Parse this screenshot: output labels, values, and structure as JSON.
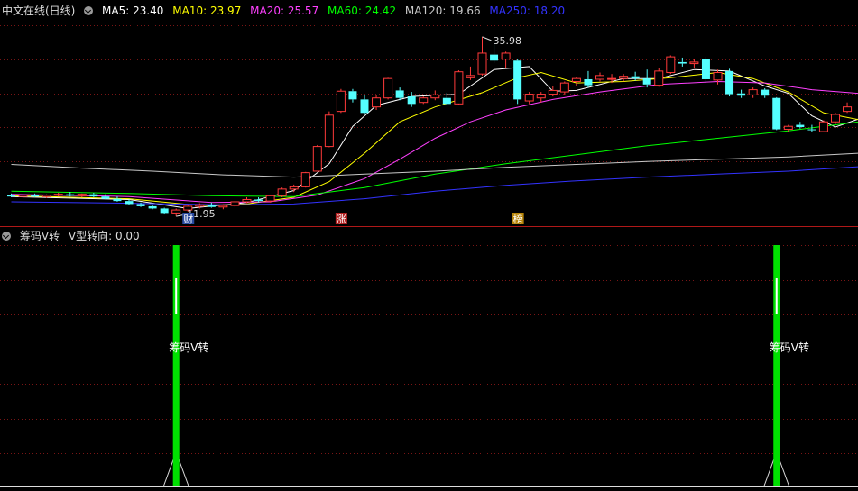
{
  "main_legend": {
    "title": "中文在线(日线)",
    "items": [
      {
        "label": "MA5: 23.40",
        "color": "#ffffff"
      },
      {
        "label": "MA10: 23.97",
        "color": "#ffff00"
      },
      {
        "label": "MA20: 25.57",
        "color": "#ff40ff"
      },
      {
        "label": "MA60: 24.42",
        "color": "#00ff00"
      },
      {
        "label": "MA120: 19.66",
        "color": "#c8c8c8"
      },
      {
        "label": "MA250: 18.20",
        "color": "#3333ff"
      }
    ]
  },
  "sub_legend": {
    "indicator": "筹码V转",
    "value_label": "V型转向: 0.00"
  },
  "annotations": {
    "high": "35.98",
    "low": "11.95",
    "markers": [
      {
        "text": "财",
        "bg": "#2a4aa0"
      },
      {
        "text": "涨",
        "bg": "#b22222"
      },
      {
        "text": "榜",
        "bg": "#b8860b"
      }
    ],
    "signal_label": "筹码V转"
  },
  "colors": {
    "up": "#ff3a3a",
    "down": "#54ffff",
    "grid": "#7a1515",
    "signal": "#00e000"
  },
  "chart_data": [
    {
      "type": "candlestick",
      "title": "中文在线(日线)",
      "note": "OHLC values estimated from candle shapes; y in price units",
      "ylim": [
        11,
        38.5
      ],
      "candles": [
        {
          "o": 14.8,
          "h": 15.0,
          "l": 14.5,
          "c": 14.6
        },
        {
          "o": 14.6,
          "h": 14.9,
          "l": 14.4,
          "c": 14.8
        },
        {
          "o": 14.8,
          "h": 15.0,
          "l": 14.5,
          "c": 14.6
        },
        {
          "o": 14.6,
          "h": 14.9,
          "l": 14.4,
          "c": 14.8
        },
        {
          "o": 14.8,
          "h": 15.1,
          "l": 14.6,
          "c": 14.9
        },
        {
          "o": 14.9,
          "h": 15.2,
          "l": 14.6,
          "c": 14.7
        },
        {
          "o": 14.7,
          "h": 15.0,
          "l": 14.5,
          "c": 14.9
        },
        {
          "o": 14.9,
          "h": 15.1,
          "l": 14.5,
          "c": 14.6
        },
        {
          "o": 14.6,
          "h": 14.9,
          "l": 14.2,
          "c": 14.3
        },
        {
          "o": 14.3,
          "h": 14.6,
          "l": 13.9,
          "c": 14.0
        },
        {
          "o": 14.0,
          "h": 14.2,
          "l": 13.5,
          "c": 13.6
        },
        {
          "o": 13.6,
          "h": 13.8,
          "l": 13.2,
          "c": 13.3
        },
        {
          "o": 13.3,
          "h": 13.5,
          "l": 12.9,
          "c": 13.0
        },
        {
          "o": 13.0,
          "h": 13.1,
          "l": 12.2,
          "c": 12.4
        },
        {
          "o": 12.4,
          "h": 13.0,
          "l": 11.95,
          "c": 12.8
        },
        {
          "o": 12.8,
          "h": 13.4,
          "l": 12.6,
          "c": 13.3
        },
        {
          "o": 13.3,
          "h": 13.7,
          "l": 13.0,
          "c": 13.5
        },
        {
          "o": 13.5,
          "h": 13.8,
          "l": 13.1,
          "c": 13.2
        },
        {
          "o": 13.2,
          "h": 13.6,
          "l": 12.9,
          "c": 13.4
        },
        {
          "o": 13.4,
          "h": 14.0,
          "l": 13.2,
          "c": 13.9
        },
        {
          "o": 13.9,
          "h": 14.5,
          "l": 13.7,
          "c": 14.2
        },
        {
          "o": 14.2,
          "h": 14.5,
          "l": 13.8,
          "c": 14.0
        },
        {
          "o": 14.0,
          "h": 14.8,
          "l": 13.8,
          "c": 14.7
        },
        {
          "o": 14.7,
          "h": 15.8,
          "l": 14.5,
          "c": 15.6
        },
        {
          "o": 15.6,
          "h": 16.2,
          "l": 15.2,
          "c": 15.9
        },
        {
          "o": 15.9,
          "h": 17.9,
          "l": 15.8,
          "c": 17.8
        },
        {
          "o": 18.0,
          "h": 21.5,
          "l": 18.0,
          "c": 21.3
        },
        {
          "o": 21.3,
          "h": 26.0,
          "l": 21.2,
          "c": 25.5
        },
        {
          "o": 26.0,
          "h": 29.0,
          "l": 25.8,
          "c": 28.7
        },
        {
          "o": 28.7,
          "h": 29.0,
          "l": 27.2,
          "c": 27.6
        },
        {
          "o": 27.6,
          "h": 28.2,
          "l": 25.6,
          "c": 25.8
        },
        {
          "o": 26.6,
          "h": 28.2,
          "l": 26.2,
          "c": 27.8
        },
        {
          "o": 27.8,
          "h": 30.5,
          "l": 27.6,
          "c": 30.4
        },
        {
          "o": 28.8,
          "h": 29.2,
          "l": 27.5,
          "c": 27.8
        },
        {
          "o": 28.0,
          "h": 28.6,
          "l": 26.6,
          "c": 27.0
        },
        {
          "o": 27.2,
          "h": 28.0,
          "l": 27.0,
          "c": 27.8
        },
        {
          "o": 27.8,
          "h": 28.8,
          "l": 27.5,
          "c": 28.2
        },
        {
          "o": 27.8,
          "h": 28.5,
          "l": 26.8,
          "c": 27.0
        },
        {
          "o": 27.0,
          "h": 31.5,
          "l": 26.8,
          "c": 31.3
        },
        {
          "o": 30.5,
          "h": 32.0,
          "l": 30.2,
          "c": 30.8
        },
        {
          "o": 31.0,
          "h": 35.98,
          "l": 30.8,
          "c": 33.8
        },
        {
          "o": 33.6,
          "h": 35.0,
          "l": 32.5,
          "c": 32.8
        },
        {
          "o": 33.0,
          "h": 34.0,
          "l": 31.8,
          "c": 33.8
        },
        {
          "o": 32.8,
          "h": 33.0,
          "l": 27.0,
          "c": 27.6
        },
        {
          "o": 27.4,
          "h": 28.6,
          "l": 27.0,
          "c": 28.3
        },
        {
          "o": 27.8,
          "h": 28.6,
          "l": 27.2,
          "c": 28.3
        },
        {
          "o": 28.3,
          "h": 29.4,
          "l": 28.0,
          "c": 28.8
        },
        {
          "o": 28.6,
          "h": 30.0,
          "l": 28.2,
          "c": 29.8
        },
        {
          "o": 30.0,
          "h": 30.6,
          "l": 29.4,
          "c": 30.4
        },
        {
          "o": 30.3,
          "h": 31.4,
          "l": 29.2,
          "c": 29.5
        },
        {
          "o": 30.3,
          "h": 31.2,
          "l": 30.0,
          "c": 30.8
        },
        {
          "o": 30.4,
          "h": 31.0,
          "l": 29.8,
          "c": 30.4
        },
        {
          "o": 30.4,
          "h": 31.0,
          "l": 30.0,
          "c": 30.7
        },
        {
          "o": 30.7,
          "h": 31.3,
          "l": 30.1,
          "c": 30.4
        },
        {
          "o": 30.4,
          "h": 31.6,
          "l": 29.2,
          "c": 29.6
        },
        {
          "o": 29.5,
          "h": 31.8,
          "l": 29.3,
          "c": 31.4
        },
        {
          "o": 31.2,
          "h": 33.5,
          "l": 31.0,
          "c": 33.3
        },
        {
          "o": 32.6,
          "h": 33.2,
          "l": 32.0,
          "c": 32.4
        },
        {
          "o": 32.4,
          "h": 33.0,
          "l": 31.8,
          "c": 32.6
        },
        {
          "o": 33.0,
          "h": 33.3,
          "l": 29.8,
          "c": 30.3
        },
        {
          "o": 30.2,
          "h": 31.6,
          "l": 29.6,
          "c": 31.2
        },
        {
          "o": 31.4,
          "h": 31.7,
          "l": 28.0,
          "c": 28.3
        },
        {
          "o": 28.4,
          "h": 28.9,
          "l": 27.8,
          "c": 28.1
        },
        {
          "o": 28.2,
          "h": 29.2,
          "l": 27.8,
          "c": 28.9
        },
        {
          "o": 28.9,
          "h": 29.1,
          "l": 27.8,
          "c": 28.1
        },
        {
          "o": 27.8,
          "h": 27.9,
          "l": 23.5,
          "c": 23.6
        },
        {
          "o": 23.6,
          "h": 24.2,
          "l": 23.3,
          "c": 24.0
        },
        {
          "o": 24.2,
          "h": 24.6,
          "l": 23.7,
          "c": 23.9
        },
        {
          "o": 23.6,
          "h": 24.2,
          "l": 23.3,
          "c": 23.5
        },
        {
          "o": 23.3,
          "h": 24.8,
          "l": 23.2,
          "c": 24.6
        },
        {
          "o": 24.6,
          "h": 25.8,
          "l": 24.3,
          "c": 25.6
        },
        {
          "o": 26.0,
          "h": 27.2,
          "l": 25.8,
          "c": 26.6
        }
      ],
      "moving_averages": [
        {
          "name": "MA5",
          "color": "#ffffff",
          "values": [
            [
              0,
              14.6
            ],
            [
              10,
              14.2
            ],
            [
              15,
              13.0
            ],
            [
              20,
              13.8
            ],
            [
              24,
              15.4
            ],
            [
              27,
              19.0
            ],
            [
              29,
              24.0
            ],
            [
              31,
              26.8
            ],
            [
              34,
              28.0
            ],
            [
              38,
              28.3
            ],
            [
              41,
              31.6
            ],
            [
              44,
              32.0
            ],
            [
              46,
              28.7
            ],
            [
              48,
              28.8
            ],
            [
              52,
              30.4
            ],
            [
              55,
              30.4
            ],
            [
              58,
              31.6
            ],
            [
              61,
              31.4
            ],
            [
              64,
              29.4
            ],
            [
              66,
              28.4
            ],
            [
              68,
              25.4
            ],
            [
              70,
              23.9
            ],
            [
              72,
              25.0
            ]
          ]
        },
        {
          "name": "MA10",
          "color": "#ffff00",
          "values": [
            [
              0,
              14.7
            ],
            [
              10,
              14.3
            ],
            [
              16,
              13.4
            ],
            [
              20,
              13.6
            ],
            [
              24,
              14.5
            ],
            [
              27,
              16.6
            ],
            [
              30,
              20.4
            ],
            [
              33,
              24.6
            ],
            [
              36,
              26.6
            ],
            [
              40,
              28.5
            ],
            [
              43,
              30.5
            ],
            [
              45,
              31.2
            ],
            [
              48,
              29.8
            ],
            [
              52,
              30.0
            ],
            [
              56,
              30.5
            ],
            [
              60,
              31.2
            ],
            [
              63,
              30.4
            ],
            [
              66,
              28.6
            ],
            [
              69,
              25.8
            ],
            [
              72,
              24.9
            ]
          ]
        },
        {
          "name": "MA20",
          "color": "#ff40ff",
          "values": [
            [
              0,
              14.9
            ],
            [
              10,
              14.6
            ],
            [
              17,
              13.8
            ],
            [
              22,
              13.9
            ],
            [
              26,
              14.8
            ],
            [
              30,
              17.0
            ],
            [
              33,
              19.6
            ],
            [
              36,
              22.4
            ],
            [
              39,
              24.6
            ],
            [
              42,
              26.2
            ],
            [
              46,
              27.6
            ],
            [
              50,
              28.6
            ],
            [
              55,
              29.6
            ],
            [
              60,
              30.0
            ],
            [
              64,
              29.8
            ],
            [
              68,
              28.9
            ],
            [
              72,
              28.4
            ]
          ]
        },
        {
          "name": "MA60",
          "color": "#00ff00",
          "values": [
            [
              0,
              15.3
            ],
            [
              10,
              15.0
            ],
            [
              17,
              14.7
            ],
            [
              24,
              14.6
            ],
            [
              30,
              15.8
            ],
            [
              36,
              17.6
            ],
            [
              42,
              19.0
            ],
            [
              48,
              20.2
            ],
            [
              54,
              21.4
            ],
            [
              60,
              22.4
            ],
            [
              66,
              23.4
            ],
            [
              72,
              24.6
            ]
          ]
        },
        {
          "name": "MA120",
          "color": "#c8c8c8",
          "values": [
            [
              0,
              18.9
            ],
            [
              6,
              18.4
            ],
            [
              12,
              18.0
            ],
            [
              18,
              17.5
            ],
            [
              24,
              17.2
            ],
            [
              30,
              17.6
            ],
            [
              36,
              18.0
            ],
            [
              42,
              18.5
            ],
            [
              48,
              18.9
            ],
            [
              54,
              19.3
            ],
            [
              60,
              19.6
            ],
            [
              66,
              19.9
            ],
            [
              72,
              20.4
            ]
          ]
        },
        {
          "name": "MA250",
          "color": "#3333ff",
          "values": [
            [
              0,
              13.9
            ],
            [
              10,
              13.7
            ],
            [
              18,
              13.5
            ],
            [
              24,
              13.6
            ],
            [
              30,
              14.3
            ],
            [
              36,
              15.3
            ],
            [
              42,
              16.1
            ],
            [
              48,
              16.7
            ],
            [
              54,
              17.2
            ],
            [
              60,
              17.6
            ],
            [
              66,
              18.0
            ],
            [
              72,
              18.6
            ]
          ]
        }
      ]
    },
    {
      "type": "bar",
      "title": "筹码V转",
      "ylim": [
        0,
        1
      ],
      "x": [
        14,
        65
      ],
      "values": [
        1,
        1
      ],
      "signal_label": "筹码V转",
      "value_label": "V型转向: 0.00"
    }
  ]
}
